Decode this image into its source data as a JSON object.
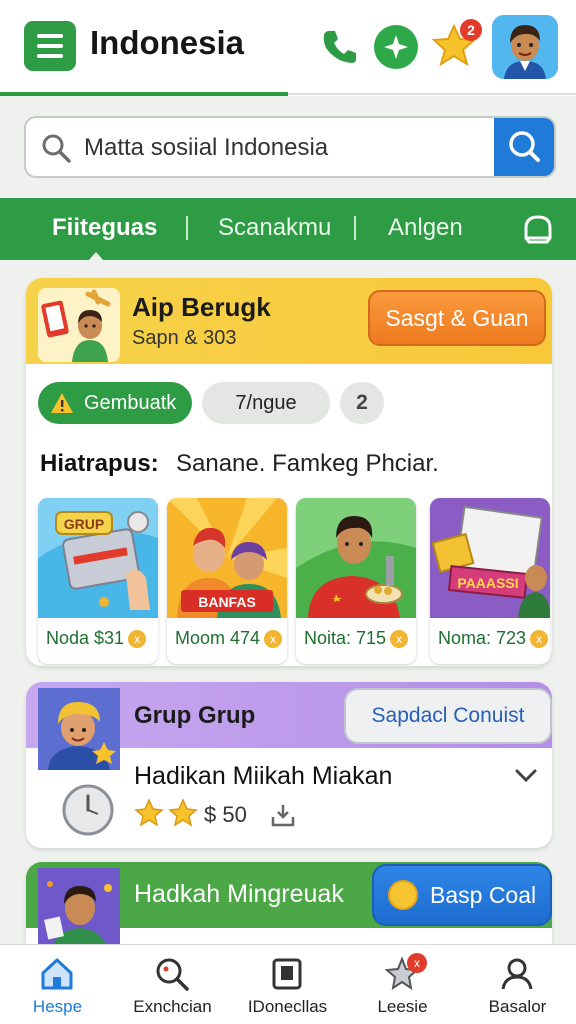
{
  "header": {
    "title": "Indonesia",
    "notification_count": "2",
    "icons": [
      "menu-icon",
      "phone-icon",
      "plus-icon",
      "star-icon",
      "avatar"
    ]
  },
  "search": {
    "placeholder": "Matta sosiial Indonesia"
  },
  "tabs": [
    {
      "label": "Fiiteguas",
      "active": true
    },
    {
      "label": "Scanakmu",
      "active": false
    },
    {
      "label": "Anlgen",
      "active": false
    }
  ],
  "card1": {
    "title": "Aip Berugk",
    "subtitle": "Sapn & 303",
    "cta": "Sasgt & Guan",
    "chips": [
      "Gembuatk",
      "7/ngue",
      "2"
    ],
    "desc_label": "Hiatrapus:",
    "desc_text": "Sanane. Famkeg Phciar.",
    "tiles": [
      {
        "caption": "Noda $31",
        "art_text": "GRUP"
      },
      {
        "caption": "Moom 474",
        "art_text": "BANFAS"
      },
      {
        "caption": "Noita: 715",
        "art_text": ""
      },
      {
        "caption": "Noma: 723",
        "art_text": "PAAASSI"
      }
    ]
  },
  "card2": {
    "title": "Grup Grup",
    "cta": "Sapdacl Conuist",
    "line": "Hadikan Miikah Miakan",
    "price": "$ 50"
  },
  "card3": {
    "title": "Hadkah Mingreuak",
    "cta": "Basp Coal"
  },
  "bottom_nav": [
    {
      "label": "Hespe",
      "active": true
    },
    {
      "label": "Exnchcian",
      "active": false
    },
    {
      "label": "IDonecllas",
      "active": false
    },
    {
      "label": "Leesie",
      "active": false,
      "badge": "x"
    },
    {
      "label": "Basalor",
      "active": false
    }
  ],
  "colors": {
    "brand_green": "#2e9b45",
    "accent_blue": "#1f7ad8",
    "accent_orange": "#f0801f",
    "accent_yellow": "#f6d24a",
    "accent_purple": "#b48ee8"
  }
}
